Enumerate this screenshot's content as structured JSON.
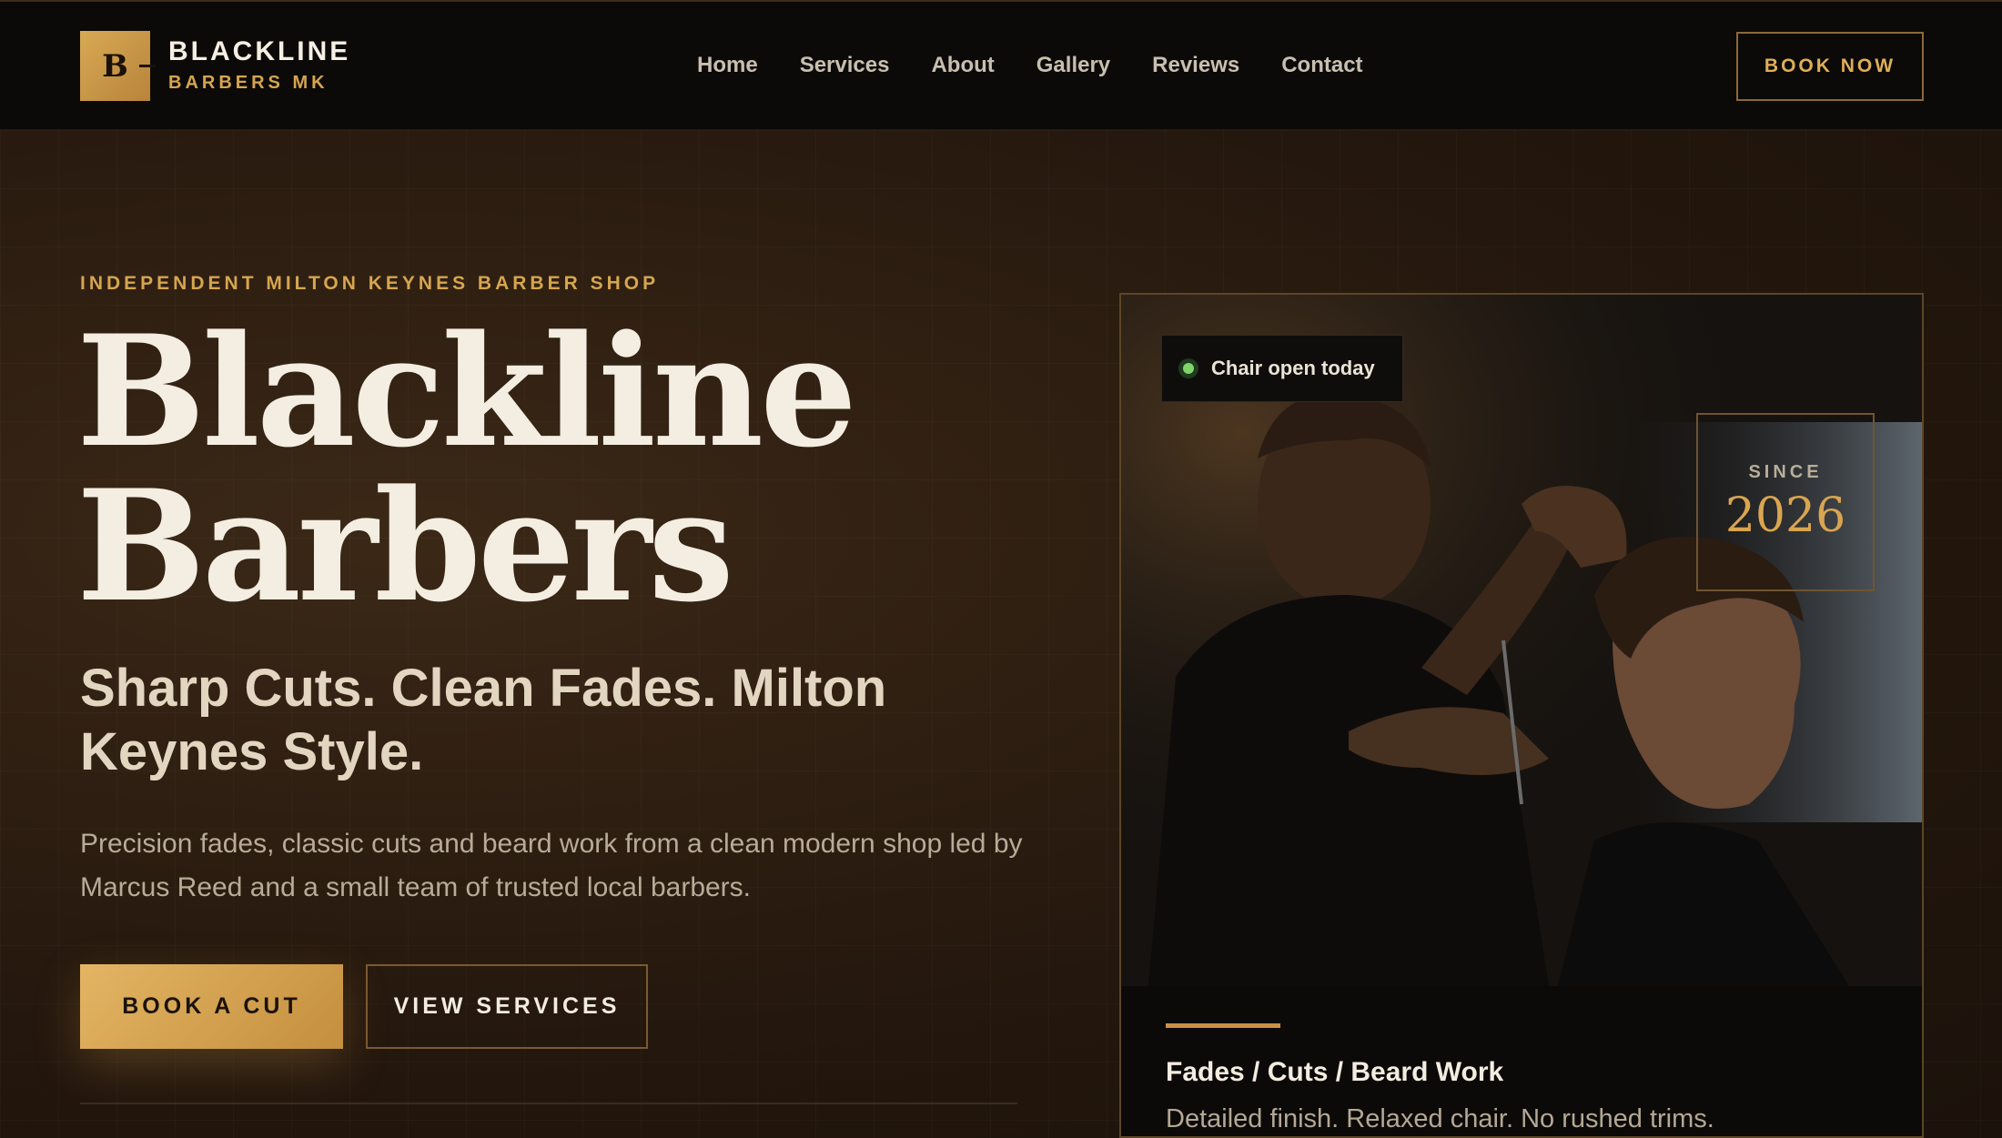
{
  "brand": {
    "mark": "B",
    "name": "BLACKLINE",
    "sub": "BARBERS MK"
  },
  "nav": {
    "items": [
      "Home",
      "Services",
      "About",
      "Gallery",
      "Reviews",
      "Contact"
    ],
    "cta": "BOOK NOW"
  },
  "hero": {
    "eyebrow": "INDEPENDENT MILTON KEYNES BARBER SHOP",
    "title_line1": "Blackline",
    "title_line2": "Barbers",
    "subtitle": "Sharp Cuts. Clean Fades. Milton Keynes Style.",
    "lead": "Precision fades, classic cuts and beard work from a clean modern shop led by Marcus Reed and a small team of trusted local barbers.",
    "primary_cta": "BOOK A CUT",
    "secondary_cta": "VIEW SERVICES"
  },
  "card": {
    "status": "Chair open today",
    "since_label": "SINCE",
    "since_year": "2026",
    "heading": "Fades / Cuts / Beard Work",
    "text": "Detailed finish. Relaxed chair. No rushed trims."
  },
  "colors": {
    "accent": "#d6a54f",
    "header_bg": "#0c0a08",
    "hero_bg": "#24170d",
    "status_dot": "#7fd46a"
  }
}
